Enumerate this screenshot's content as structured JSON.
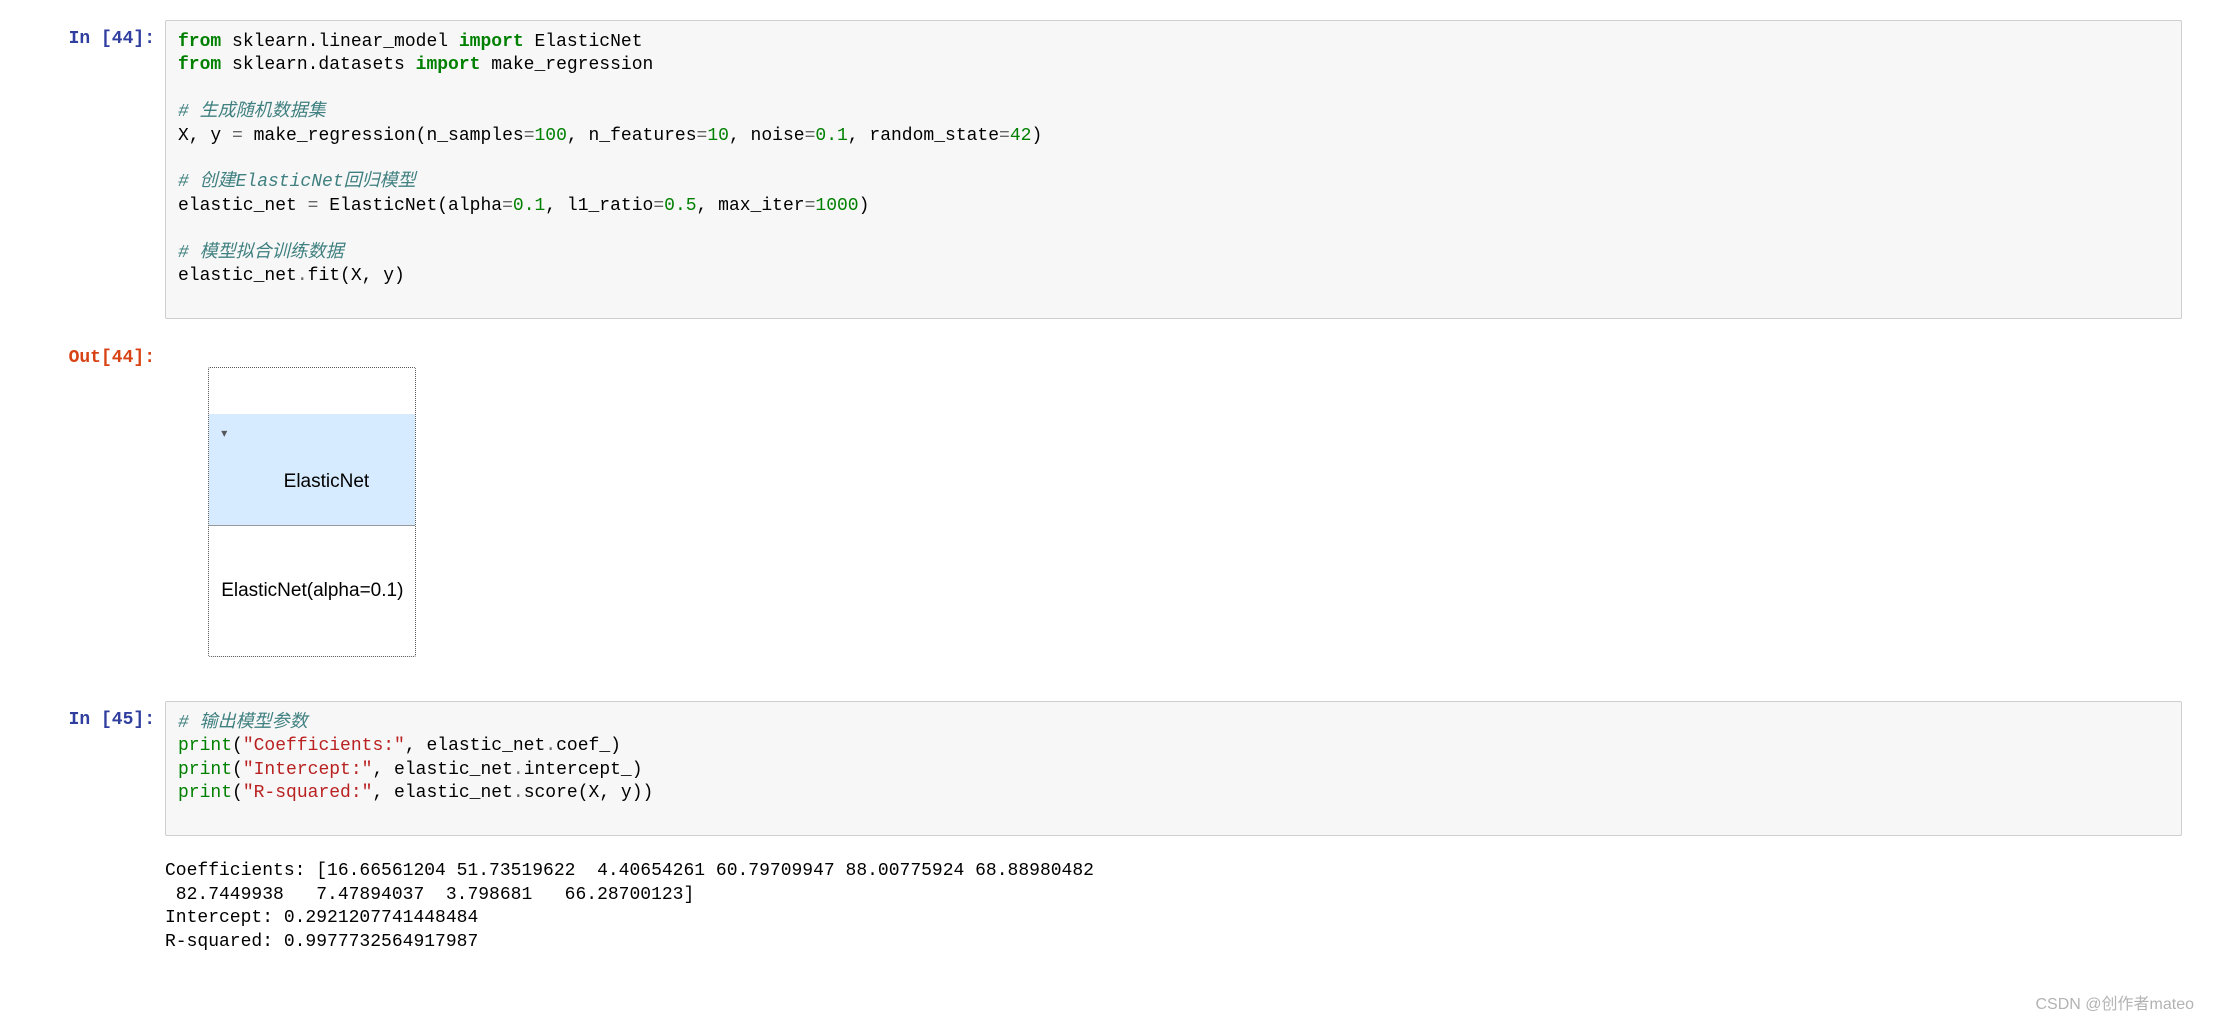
{
  "cells": {
    "c44_prompt": "In [44]:",
    "c44_out_prompt": "Out[44]:",
    "c45_prompt": "In [45]:",
    "c44_code": {
      "l1a": "from",
      "l1b": " sklearn.linear_model ",
      "l1c": "import",
      "l1d": " ElasticNet",
      "l2a": "from",
      "l2b": " sklearn.datasets ",
      "l2c": "import",
      "l2d": " make_regression",
      "l3": "",
      "l4": "# 生成随机数据集",
      "l5a": "X, y ",
      "l5b": "=",
      "l5c": " make_regression(n_samples",
      "l5d": "=",
      "l5e": "100",
      "l5f": ", n_features",
      "l5g": "=",
      "l5h": "10",
      "l5i": ", noise",
      "l5j": "=",
      "l5k": "0.1",
      "l5l": ", random_state",
      "l5m": "=",
      "l5n": "42",
      "l5o": ")",
      "l6": "",
      "l7": "# 创建ElasticNet回归模型",
      "l8a": "elastic_net ",
      "l8b": "=",
      "l8c": " ElasticNet(alpha",
      "l8d": "=",
      "l8e": "0.1",
      "l8f": ", l1_ratio",
      "l8g": "=",
      "l8h": "0.5",
      "l8i": ", max_iter",
      "l8j": "=",
      "l8k": "1000",
      "l8l": ")",
      "l9": "",
      "l10": "# 模型拟合训练数据",
      "l11a": "elastic_net",
      "l11b": ".",
      "l11c": "fit(X, y)"
    },
    "c44_output": {
      "header_tri": "▾",
      "header_title": "ElasticNet",
      "body": "ElasticNet(alpha=0.1)"
    },
    "c45_code": {
      "l1": "# 输出模型参数",
      "l2a": "print",
      "l2b": "(",
      "l2c": "\"Coefficients:\"",
      "l2d": ", elastic_net",
      "l2e": ".",
      "l2f": "coef_)",
      "l3a": "print",
      "l3b": "(",
      "l3c": "\"Intercept:\"",
      "l3d": ", elastic_net",
      "l3e": ".",
      "l3f": "intercept_)",
      "l4a": "print",
      "l4b": "(",
      "l4c": "\"R-squared:\"",
      "l4d": ", elastic_net",
      "l4e": ".",
      "l4f": "score(X, y))"
    },
    "c45_output": "Coefficients: [16.66561204 51.73519622  4.40654261 60.79709947 88.00775924 68.88980482\n 82.7449938   7.47894037  3.798681   66.28700123]\nIntercept: 0.2921207741448484\nR-squared: 0.9977732564917987"
  },
  "watermark": "CSDN @创作者mateo"
}
